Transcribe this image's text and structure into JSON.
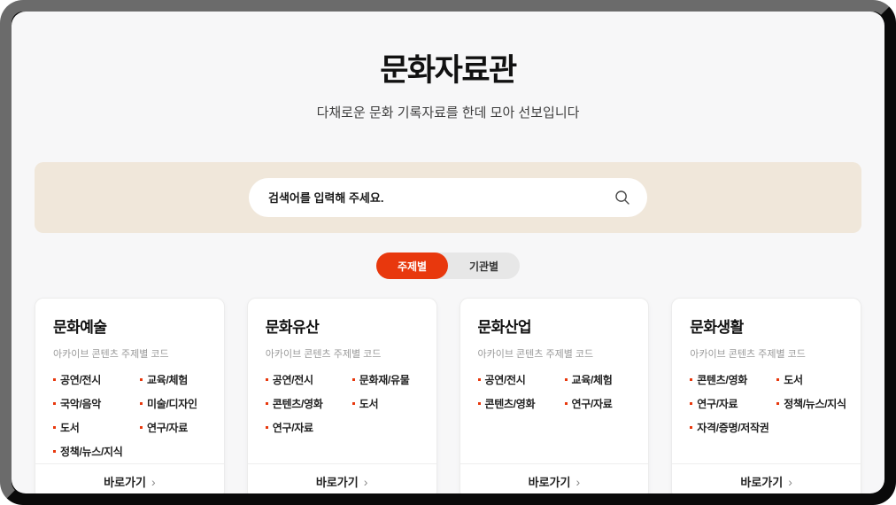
{
  "page": {
    "title": "문화자료관",
    "subtitle": "다채로운 문화 기록자료를 한데 모아 선보입니다"
  },
  "search": {
    "placeholder": "검색어를 입력해 주세요."
  },
  "tabs": [
    {
      "label": "주제별",
      "active": true
    },
    {
      "label": "기관별",
      "active": false
    }
  ],
  "colors": {
    "accent": "#e8380d",
    "search_section_bg": "#f0e7da",
    "page_bg": "#f7f7f8"
  },
  "cta_chevron": "›",
  "cards": [
    {
      "title": "문화예술",
      "code_label": "아카이브 콘텐츠 주제별 코드",
      "columns": [
        [
          "공연/전시",
          "국악/음악",
          "도서",
          "정책/뉴스/지식"
        ],
        [
          "교육/체험",
          "미술/디자인",
          "연구/자료"
        ]
      ],
      "cta": "바로가기"
    },
    {
      "title": "문화유산",
      "code_label": "아카이브 콘텐츠 주제별 코드",
      "columns": [
        [
          "공연/전시",
          "콘텐츠/영화",
          "연구/자료"
        ],
        [
          "문화재/유물",
          "도서"
        ]
      ],
      "cta": "바로가기"
    },
    {
      "title": "문화산업",
      "code_label": "아카이브 콘텐츠 주제별 코드",
      "columns": [
        [
          "공연/전시",
          "콘텐츠/영화"
        ],
        [
          "교육/체험",
          "연구/자료"
        ]
      ],
      "cta": "바로가기"
    },
    {
      "title": "문화생활",
      "code_label": "아카이브 콘텐츠 주제별 코드",
      "columns": [
        [
          "콘텐츠/영화",
          "연구/자료",
          "자격/증명/저작권"
        ],
        [
          "도서",
          "정책/뉴스/지식"
        ]
      ],
      "cta": "바로가기"
    }
  ]
}
